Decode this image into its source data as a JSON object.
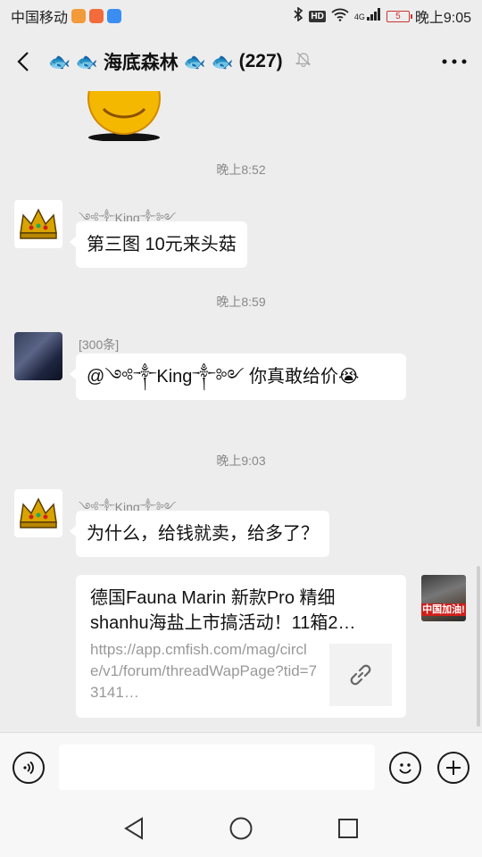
{
  "status_bar": {
    "carrier": "中国移动",
    "network": "4G",
    "battery": "5",
    "time": "晚上9:05"
  },
  "header": {
    "back_icon": "back-arrow-icon",
    "fish_emoji": "🐟",
    "group_name": "海底森林",
    "member_count": "(227)",
    "mute_icon": "bell-muted-icon",
    "more_icon": "more-dots-icon"
  },
  "messages": [
    {
      "type": "timestamp",
      "text": "晚上8:52"
    },
    {
      "type": "message",
      "sender": "༺༒King༒༻",
      "text": "第三图 10元来头菇"
    },
    {
      "type": "timestamp",
      "text": "晚上8:59"
    },
    {
      "type": "message",
      "sender": "[300条]",
      "text": "@༺༒King༒༻ 你真敢给价😭"
    },
    {
      "type": "timestamp",
      "text": "晚上9:03"
    },
    {
      "type": "message",
      "sender": "༺༒King༒༻",
      "text": "为什么，给钱就卖，给多了？"
    }
  ],
  "link_card": {
    "title": "德国Fauna Marin 新款Pro 精细shanhu海盐上市搞活动！11箱2…",
    "url": "https://app.cmfish.com/mag/circle/v1/forum/threadWapPage?tid=73141…",
    "thumb_icon": "link-icon"
  },
  "self_avatar_text": "中国加油!",
  "input_bar": {
    "voice_icon": "voice-icon",
    "placeholder": "",
    "emoji_icon": "emoji-icon",
    "plus_icon": "plus-icon"
  },
  "nav_bar": {
    "back_icon": "nav-back-icon",
    "home_icon": "nav-home-icon",
    "recents_icon": "nav-recents-icon"
  }
}
